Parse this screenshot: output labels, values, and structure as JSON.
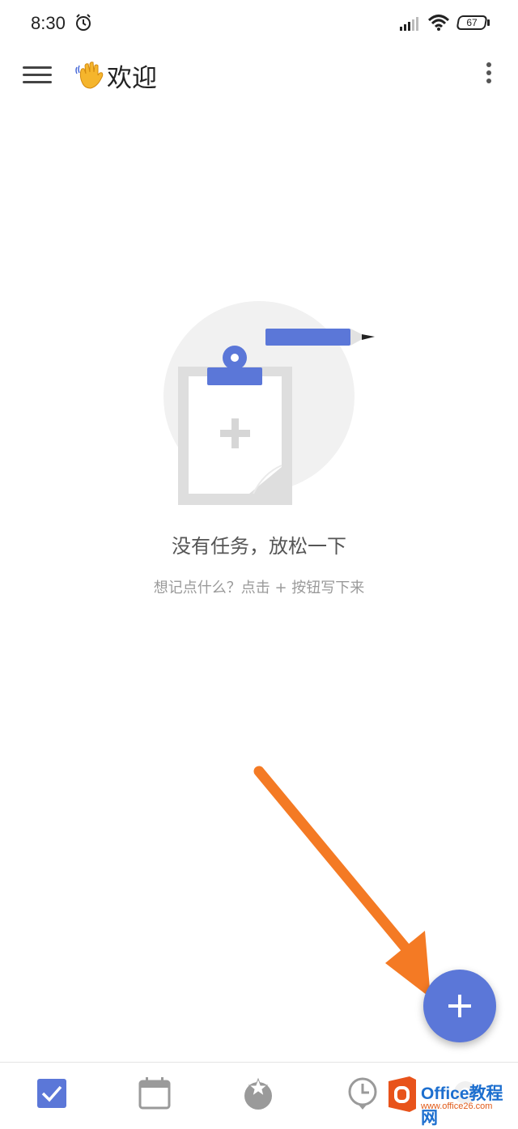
{
  "status_bar": {
    "time": "8:30",
    "battery": "67",
    "icons": [
      "alarm-icon",
      "signal-icon",
      "wifi-icon",
      "battery-icon"
    ]
  },
  "app_bar": {
    "title": "欢迎",
    "icons": [
      "menu-icon",
      "waving-hand-icon",
      "more-vert-icon"
    ]
  },
  "empty_state": {
    "title": "没有任务，放松一下",
    "hint": "想记点什么？点击 + 按钮写下来",
    "icon": "clipboard-pencil-illustration"
  },
  "fab": {
    "icon": "plus-icon",
    "color": "#5b77d8"
  },
  "bottom_nav": {
    "items": [
      {
        "icon": "checkbox-icon",
        "active": true
      },
      {
        "icon": "calendar-icon",
        "active": false
      },
      {
        "icon": "pomodoro-icon",
        "active": false
      },
      {
        "icon": "clock-icon",
        "active": false
      },
      {
        "icon": "gear-icon",
        "active": false
      }
    ]
  },
  "colors": {
    "accent": "#5b77d8",
    "arrow": "#f47a24"
  },
  "watermark": {
    "brand": "Office教程网",
    "site": "www.office26.com"
  }
}
